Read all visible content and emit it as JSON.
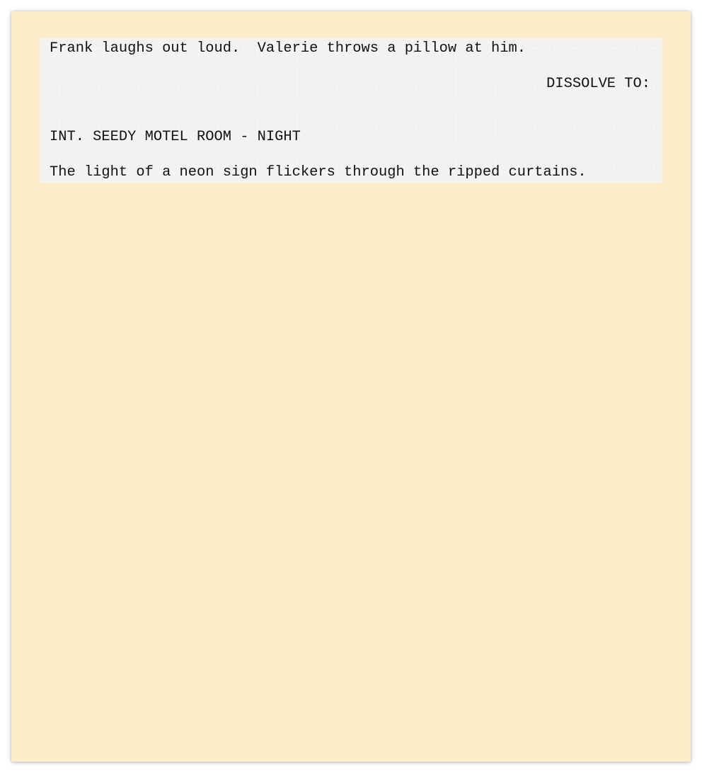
{
  "document": {
    "type": "screenplay",
    "lines": [
      {
        "kind": "action",
        "text": "Frank laughs out loud.  Valerie throws a pillow at him."
      },
      {
        "kind": "transition",
        "text": "DISSOLVE TO:"
      },
      {
        "kind": "scene_heading",
        "text": "INT. SEEDY MOTEL ROOM - NIGHT"
      },
      {
        "kind": "action",
        "text": "The light of a neon sign flickers through the ripped curtains."
      }
    ]
  },
  "colors": {
    "page_background": "#fdedc8",
    "sheet_background": "#f3f3f3",
    "text": "#111111"
  }
}
